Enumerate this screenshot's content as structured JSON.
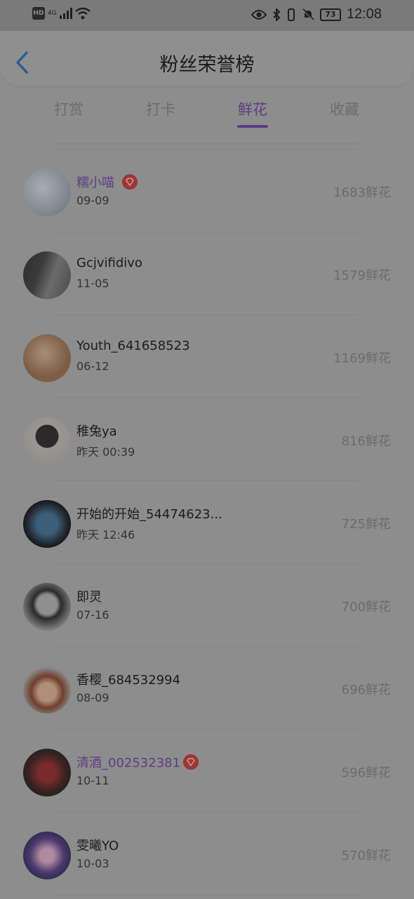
{
  "status": {
    "time": "12:08",
    "battery": "73",
    "network": "4G"
  },
  "header": {
    "title": "粉丝荣誉榜"
  },
  "tabs": [
    {
      "label": "打赏"
    },
    {
      "label": "打卡"
    },
    {
      "label": "鲜花"
    },
    {
      "label": "收藏"
    }
  ],
  "active_tab": "鲜花",
  "fans": [
    {
      "name": "糯小喵",
      "date": "09-09",
      "score": "1683鲜花",
      "vip": true
    },
    {
      "name": "Gcjvifidivo",
      "date": "11-05",
      "score": "1579鲜花",
      "vip": false
    },
    {
      "name": "Youth_641658523",
      "date": "06-12",
      "score": "1169鲜花",
      "vip": false
    },
    {
      "name": "稚兔ya",
      "date": "昨天 00:39",
      "score": "816鲜花",
      "vip": false
    },
    {
      "name": "开始的开始_54474623...",
      "date": "昨天 12:46",
      "score": "725鲜花",
      "vip": false
    },
    {
      "name": "即灵",
      "date": "07-16",
      "score": "700鲜花",
      "vip": false
    },
    {
      "name": "香樱_684532994",
      "date": "08-09",
      "score": "696鲜花",
      "vip": false
    },
    {
      "name": "清酒_002532381",
      "date": "10-11",
      "score": "596鲜花",
      "vip": true
    },
    {
      "name": "雯曦YO",
      "date": "10-03",
      "score": "570鲜花",
      "vip": false
    }
  ],
  "colors": {
    "accent": "#5e3c86",
    "vip_badge": "#9b3737"
  }
}
